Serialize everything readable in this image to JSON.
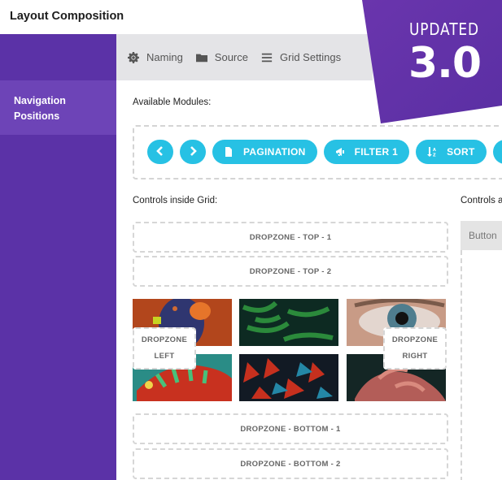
{
  "app": {
    "title": "Layout Composition"
  },
  "sidebar": {
    "items": [
      {
        "label_line1": "Navigation",
        "label_line2": "Positions",
        "active": true
      }
    ]
  },
  "tabs": [
    {
      "label": "Naming",
      "icon": "gear-icon"
    },
    {
      "label": "Source",
      "icon": "folder-icon"
    },
    {
      "label": "Grid Settings",
      "icon": "hamburger-icon"
    }
  ],
  "modules": {
    "label": "Available Modules:",
    "chips": [
      {
        "label": "",
        "icon": "chevron-left-icon"
      },
      {
        "label": "",
        "icon": "chevron-right-icon"
      },
      {
        "label": "PAGINATION",
        "icon": "file-icon"
      },
      {
        "label": "FILTER 1",
        "icon": "bullhorn-icon"
      },
      {
        "label": "SORT",
        "icon": "sort-alpha-icon"
      },
      {
        "label": "",
        "icon": "search-icon"
      }
    ]
  },
  "grid_controls": {
    "label": "Controls inside Grid:",
    "dropzones": {
      "top1": "DROPZONE - TOP - 1",
      "top2": "DROPZONE - TOP - 2",
      "left_line1": "DROPZONE",
      "left_line2": "LEFT",
      "right_line1": "DROPZONE",
      "right_line2": "RIGHT",
      "bottom1": "DROPZONE - BOTTOM - 1",
      "bottom2": "DROPZONE - BOTTOM - 2"
    },
    "images": [
      "parrot",
      "fern",
      "eye",
      "chameleon",
      "succulent",
      "flamingo"
    ]
  },
  "outside_controls": {
    "label": "Controls a",
    "button_label": "Button"
  },
  "badge": {
    "line1": "UPDATED",
    "line2": "3.0",
    "color": "#5b32a7"
  },
  "colors": {
    "accent": "#27c1e4",
    "sidebar": "#5b32a7",
    "sidebar_active": "#6d44b7"
  }
}
